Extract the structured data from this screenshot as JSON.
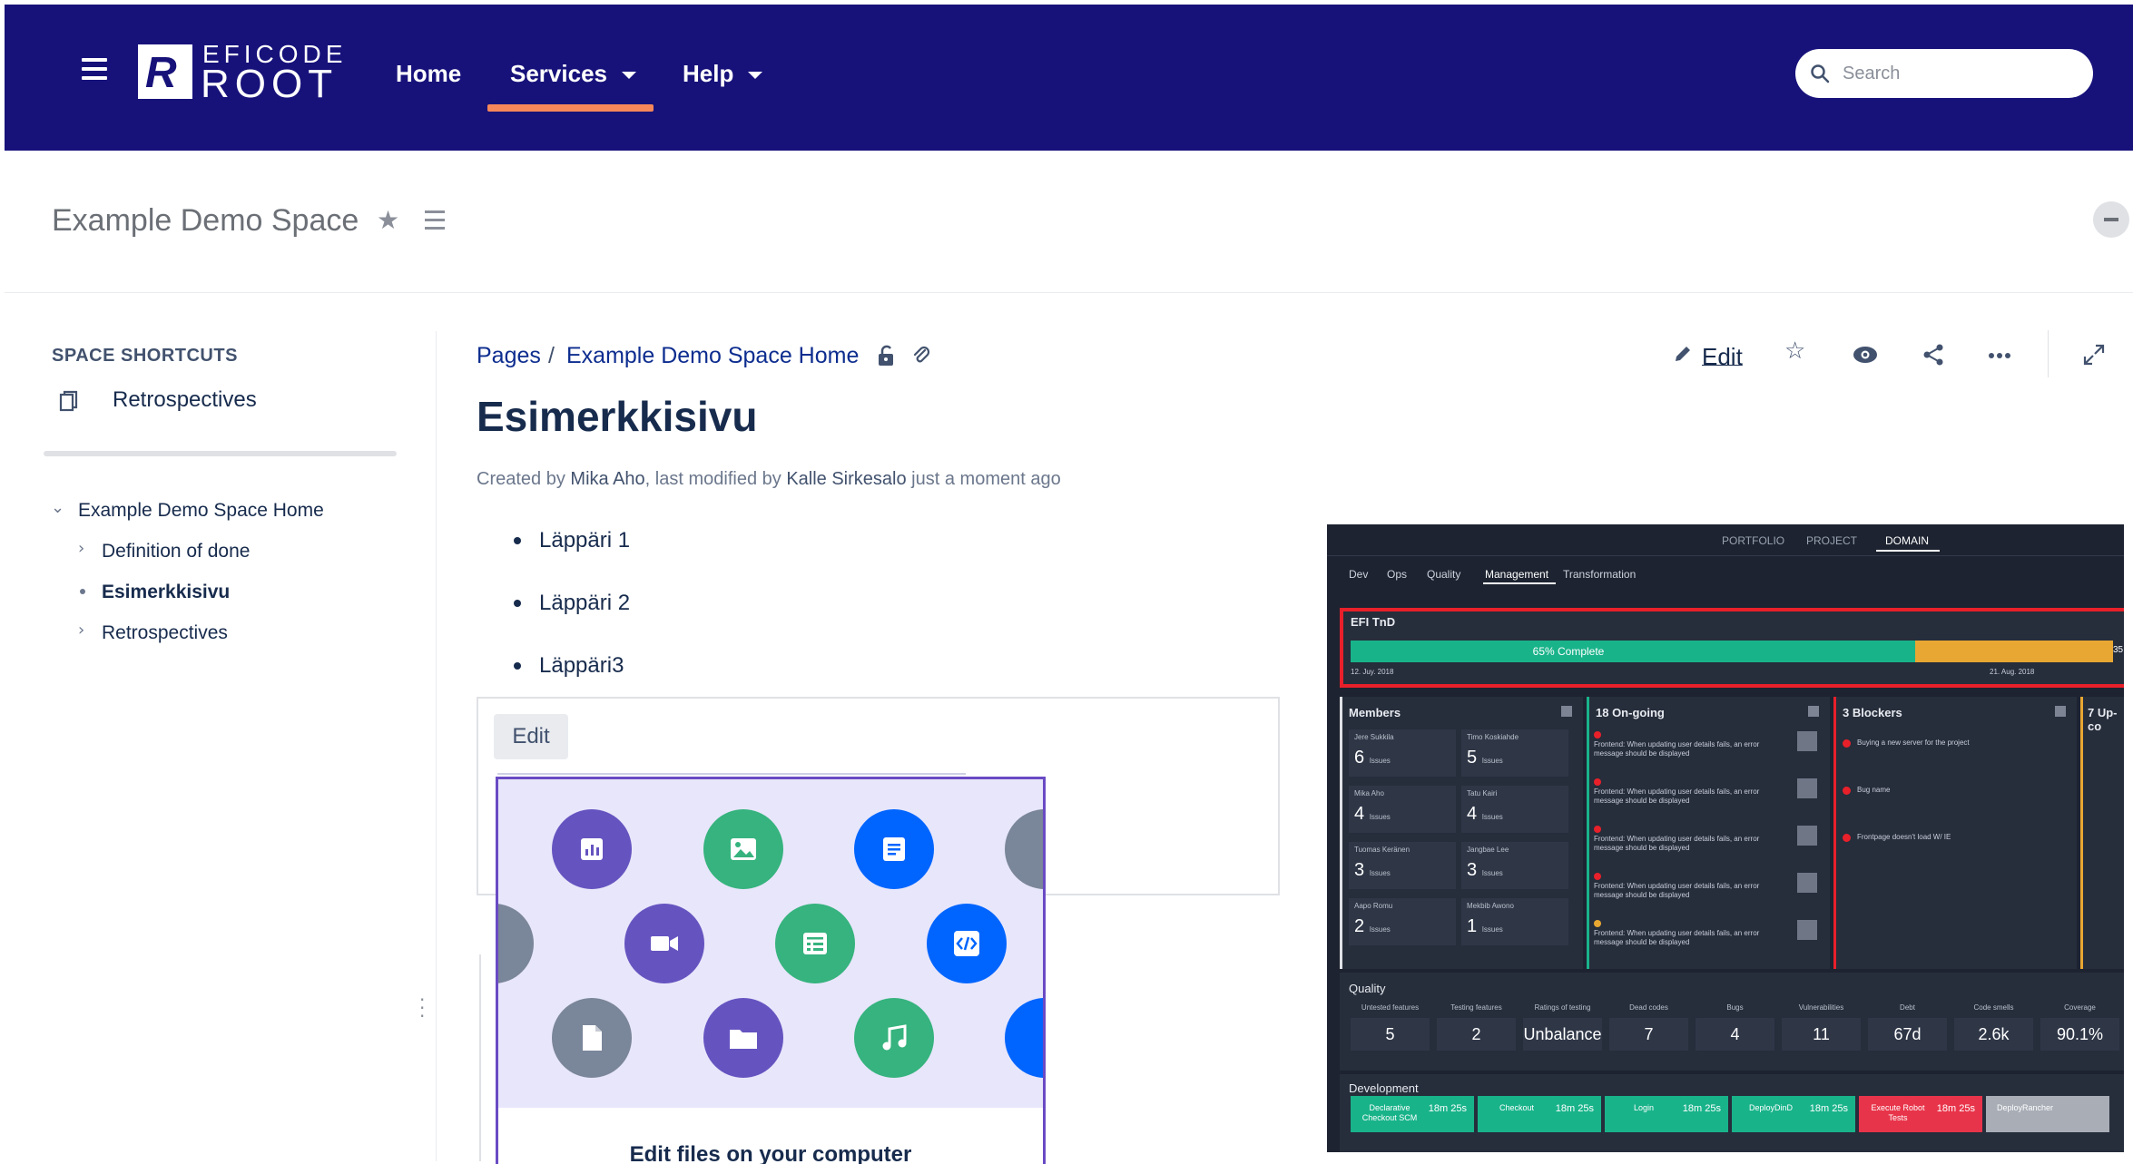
{
  "header": {
    "logo_top": "EFICODE",
    "logo_bottom": "ROOT",
    "logo_mark": "R",
    "nav": {
      "home": "Home",
      "services": "Services",
      "help": "Help"
    },
    "search_placeholder": "Search",
    "colors": {
      "bar": "#17127a",
      "active_underline": "#f5875a"
    }
  },
  "space": {
    "title": "Example Demo Space",
    "shortcuts_title": "SPACE SHORTCUTS",
    "shortcut_item": "Retrospectives",
    "tree": {
      "root": "Example Demo Space Home",
      "children": [
        "Definition of done",
        "Esimerkkisivu",
        "Retrospectives"
      ]
    }
  },
  "page": {
    "breadcrumb": {
      "pages": "Pages",
      "sep": "/",
      "home": "Example Demo Space Home"
    },
    "title": "Esimerkkisivu",
    "byline": {
      "created_by": "Created by",
      "author": "Mika Aho",
      "modified": ", last modified by",
      "modifier": "Kalle Sirkesalo",
      "when": "just a moment ago"
    },
    "actions": {
      "edit": "Edit"
    },
    "list": [
      "Läppäri 1",
      "Läppäri 2",
      "Läppäri3"
    ]
  },
  "embed": {
    "edit_button": "Edit",
    "popup_text": "Edit files on your computer",
    "icons": [
      "chart-icon",
      "image-icon",
      "document-icon",
      "video-icon",
      "spreadsheet-icon",
      "code-icon",
      "file-icon",
      "folder-icon",
      "music-icon"
    ]
  },
  "dashboard": {
    "top_tabs": [
      "PORTFOLIO",
      "PROJECT",
      "DOMAIN"
    ],
    "sub_tabs": [
      "Dev",
      "Ops",
      "Quality",
      "Management",
      "Transformation"
    ],
    "project": {
      "name": "EFI TnD",
      "progress_label": "65% Complete",
      "progress": 0.65,
      "start": "12. Juy. 2018",
      "end": "21. Aug. 2018",
      "remainder": "35"
    },
    "members": {
      "title": "Members",
      "people": [
        {
          "name": "Jere Sukkila",
          "issues": "6"
        },
        {
          "name": "Timo Koskiahde",
          "issues": "5"
        },
        {
          "name": "Mika Aho",
          "issues": "4"
        },
        {
          "name": "Tatu Kairi",
          "issues": "4"
        },
        {
          "name": "Tuomas Keränen",
          "issues": "3"
        },
        {
          "name": "Jangbae Lee",
          "issues": "3"
        },
        {
          "name": "Aapo Romu",
          "issues": "2"
        },
        {
          "name": "Mekbib Awono",
          "issues": "1"
        }
      ],
      "issues_word": "Issues"
    },
    "ongoing": {
      "title": "18 On-going",
      "items": [
        "Frontend: When updating user details fails, an error message should be displayed",
        "Frontend: When updating user details fails, an error message should be displayed",
        "Frontend: When updating user details fails, an error message should be displayed",
        "Frontend: When updating user details fails, an error message should be displayed",
        "Frontend: When updating user details fails, an error message should be displayed"
      ]
    },
    "blockers": {
      "title": "3 Blockers",
      "items": [
        "Buying a new server for the project",
        "Bug name",
        "Frontpage doesn't load W/ IE"
      ]
    },
    "upcoming": {
      "title": "7 Up-co"
    },
    "quality": {
      "title": "Quality",
      "metrics": [
        {
          "label": "Untested features",
          "value": "5"
        },
        {
          "label": "Testing features",
          "value": "2"
        },
        {
          "label": "Ratings of testing",
          "value": "Unbalance"
        },
        {
          "label": "Dead codes",
          "value": "7"
        },
        {
          "label": "Bugs",
          "value": "4"
        },
        {
          "label": "Vulnerabilities",
          "value": "11"
        },
        {
          "label": "Debt",
          "value": "67d"
        },
        {
          "label": "Code smells",
          "value": "2.6k"
        },
        {
          "label": "Coverage",
          "value": "90.1%"
        }
      ]
    },
    "development": {
      "title": "Development",
      "jobs": [
        {
          "name": "Declarative Checkout SCM",
          "time": "18m 25s"
        },
        {
          "name": "Checkout",
          "time": "18m 25s"
        },
        {
          "name": "Login",
          "time": "18m 25s"
        },
        {
          "name": "DeployDinD",
          "time": "18m 25s"
        },
        {
          "name": "Execute Robot Tests",
          "time": "18m 25s"
        },
        {
          "name": "DeployRancher",
          "time": ""
        }
      ]
    }
  }
}
